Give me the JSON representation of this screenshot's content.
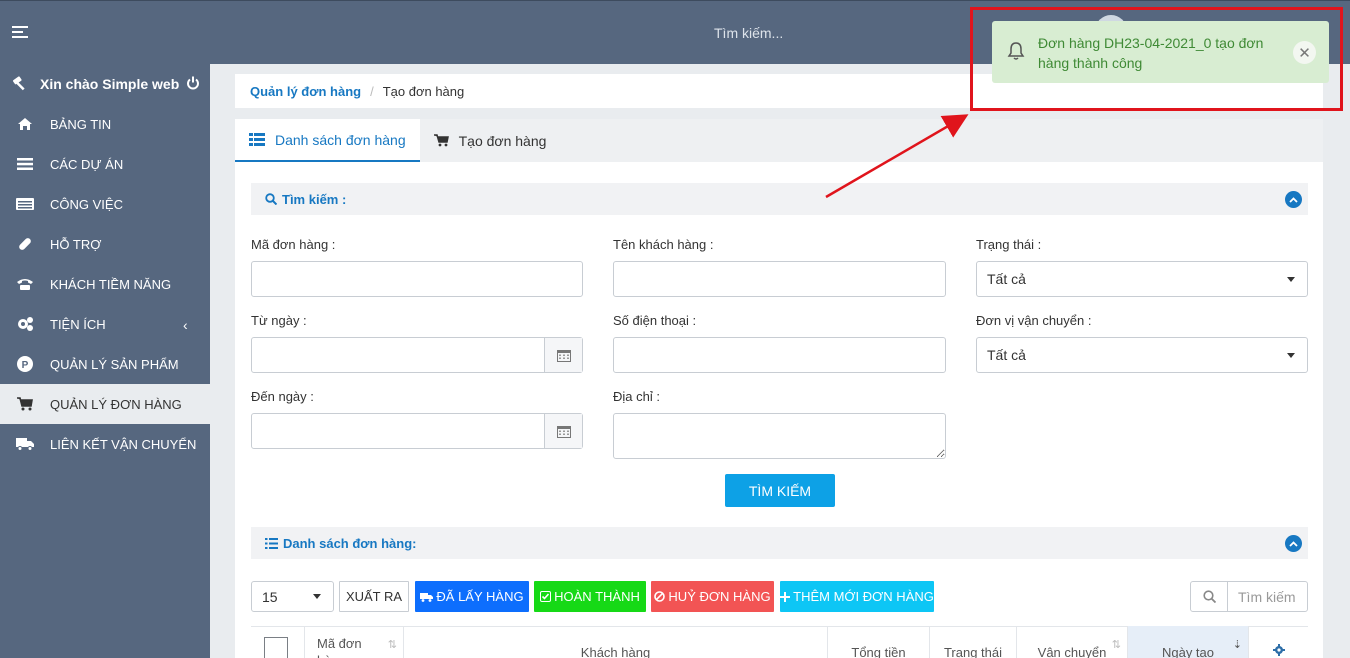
{
  "topbar": {
    "search_placeholder": "Tìm kiếm..."
  },
  "sidebar": {
    "greeting": "Xin chào Simple web",
    "items": [
      {
        "label": "BẢNG TIN",
        "icon": "home-icon"
      },
      {
        "label": "CÁC DỰ ÁN",
        "icon": "bars-icon"
      },
      {
        "label": "CÔNG VIỆC",
        "icon": "list-icon"
      },
      {
        "label": "HỖ TRỢ",
        "icon": "bandage-icon"
      },
      {
        "label": "KHÁCH TIỀM NĂNG",
        "icon": "phone-icon"
      },
      {
        "label": "TIỆN ÍCH",
        "icon": "gears-icon"
      },
      {
        "label": "QUẢN LÝ SẢN PHẨM",
        "icon": "product-icon"
      },
      {
        "label": "QUẢN LÝ ĐƠN HÀNG",
        "icon": "cart-icon"
      },
      {
        "label": "LIÊN KẾT VẬN CHUYỂN",
        "icon": "truck-icon"
      }
    ],
    "active_index": 7
  },
  "breadcrumb": {
    "parent": "Quản lý đơn hàng",
    "current": "Tạo đơn hàng"
  },
  "tabs": {
    "list": "Danh sách đơn hàng",
    "create": "Tạo đơn hàng"
  },
  "search_section": {
    "title": "Tìm kiếm :",
    "order_code_label": "Mã đơn hàng :",
    "customer_name_label": "Tên khách hàng :",
    "status_label": "Trạng thái :",
    "status_value": "Tất cả",
    "from_date_label": "Từ ngày :",
    "phone_label": "Số điện thoại :",
    "shipper_label": "Đơn vị vận chuyển :",
    "shipper_value": "Tất cả",
    "to_date_label": "Đến ngày :",
    "address_label": "Địa chỉ :",
    "search_button": "TÌM KIẾM"
  },
  "list_section": {
    "title": "Danh sách đơn hàng:",
    "page_size": "15",
    "export_button": "XUẤT RA",
    "picked_button": "ĐÃ LẤY HÀNG",
    "done_button": "HOÀN THÀNH",
    "cancel_button": "HUỶ ĐƠN HÀNG",
    "add_button": "THÊM MỚI ĐƠN HÀNG",
    "search_placeholder": "Tìm kiếm",
    "columns": [
      "Mã đơn hàng",
      "Khách hàng",
      "Tổng tiền",
      "Trạng thái",
      "Vận chuyển",
      "Ngày tạo"
    ]
  },
  "toast": {
    "message": "Đơn hàng DH23-04-2021_0 tạo đơn hàng thành công"
  },
  "colors": {
    "sidebar_bg": "#56677f",
    "accent": "#1778c2",
    "picked": "#0d6efd",
    "done": "#16d916",
    "cancel": "#f25454",
    "add": "#0dc6f5",
    "toast_bg": "#d8edd2",
    "annotation": "#e0141c"
  }
}
